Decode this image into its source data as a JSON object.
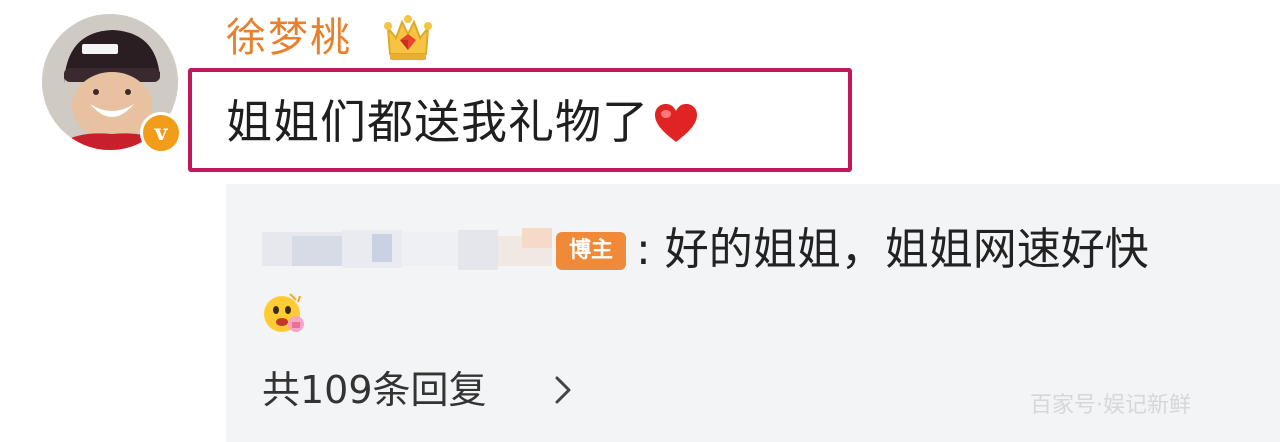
{
  "comment": {
    "username": "徐梦桃",
    "text": "姐姐们都送我礼物了",
    "avatar_icon": "avatar",
    "verified_badge": "v",
    "level_icon": "crown-diamond-icon",
    "emoji": "heart-icon"
  },
  "reply": {
    "author_badge": "博主",
    "text": ": 好的姐姐，姐姐网速好快",
    "emoji": "face-emoji-icon"
  },
  "replies_link": {
    "label": "共109条回复"
  },
  "watermark": "百家号·娱记新鲜",
  "colors": {
    "username": "#e8812f",
    "highlight_border": "#c2185b",
    "reply_bg": "#f3f4f6",
    "author_badge": "#f08a38",
    "heart": "#e02424"
  }
}
